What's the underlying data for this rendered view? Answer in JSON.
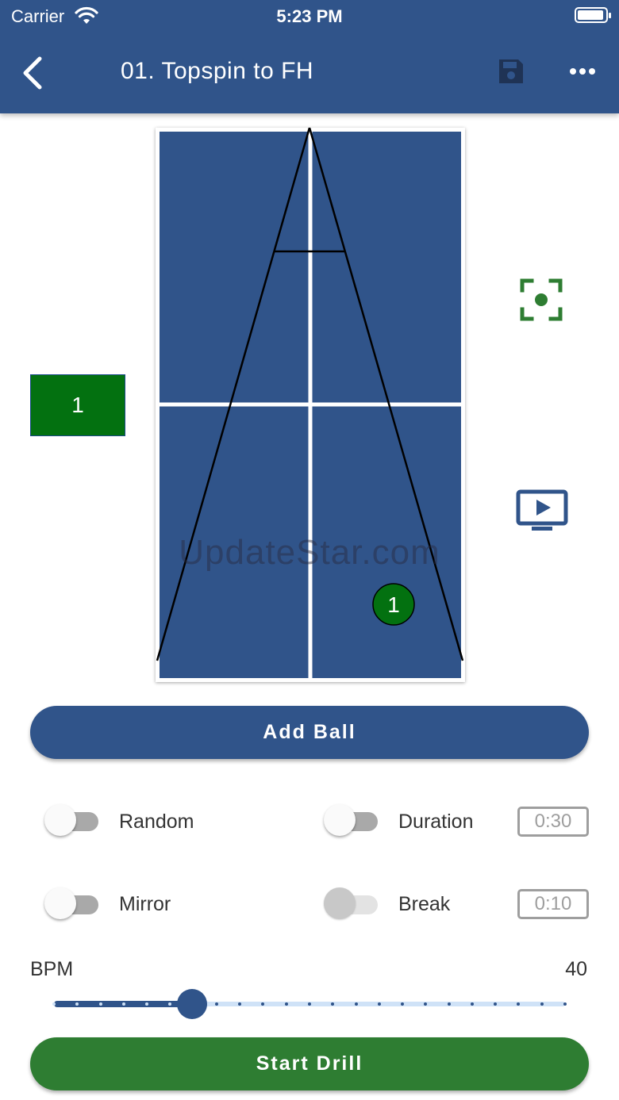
{
  "status_bar": {
    "carrier": "Carrier",
    "time": "5:23 PM"
  },
  "header": {
    "title": "01. Topspin to FH"
  },
  "table": {
    "colors": {
      "surface": "#30548a",
      "lines": "#ffffff",
      "trajectory": "#000000",
      "ball": "#037110"
    },
    "ball_number": "1"
  },
  "watermark": "UpdateStar.com",
  "ball_list": [
    {
      "label": "1"
    }
  ],
  "buttons": {
    "add_ball": "Add Ball",
    "start_drill": "Start Drill"
  },
  "options": {
    "random": {
      "label": "Random",
      "enabled": false
    },
    "mirror": {
      "label": "Mirror",
      "enabled": false
    },
    "duration": {
      "label": "Duration",
      "enabled": false,
      "value": "0:30"
    },
    "break": {
      "label": "Break",
      "enabled": false,
      "disabled": true,
      "value": "0:10"
    }
  },
  "bpm": {
    "label": "BPM",
    "value": "40",
    "fraction": 0.27,
    "steps": 23
  },
  "icons": {
    "back": "chevron-left-icon",
    "save": "floppy-disk-icon",
    "more": "ellipsis-icon",
    "focus": "focus-target-icon",
    "play": "play-screen-icon"
  },
  "colors": {
    "primary": "#30548a",
    "accent_green": "#2e7d32",
    "focus_icon": "#2e7d32"
  }
}
